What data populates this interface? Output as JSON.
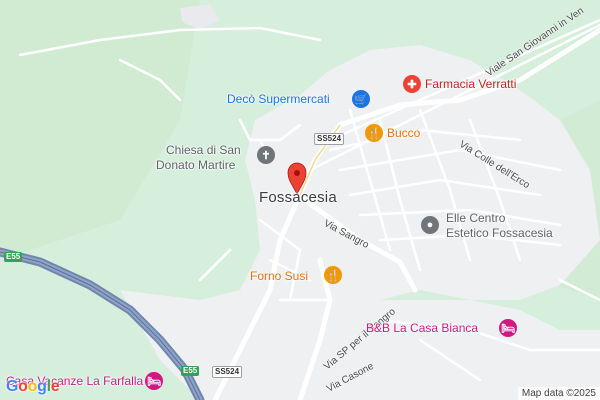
{
  "map": {
    "town": "Fossacesia",
    "roads": {
      "viale_san_giovanni": "Viale San Giovanni in Ven",
      "via_colle": "Via Colle dell'Erco",
      "via_sangro": "Via Sangro",
      "via_sp_sangro": "Via SP per il Sangro",
      "via_casone": "Via Casone",
      "ss524_top": "SS524",
      "ss524_bottom": "SS524",
      "e55_left": "E55",
      "e55_bottom": "E55"
    },
    "pois": {
      "farmacia": "Farmacia Verratti",
      "deco": "Decò Supermercati",
      "bucco": "Bucco",
      "chiesa_line1": "Chiesa di San",
      "chiesa_line2": "Donato Martire",
      "elle_line1": "Elle Centro",
      "elle_line2": "Estetico Fossacesia",
      "forno": "Forno Susi",
      "bnb": "B&B La Casa Bianca",
      "farfalla": "Casa Vacanze La Farfalla"
    },
    "attribution": "Map data ©2025",
    "logo": "Google",
    "colors": {
      "land": "#d6eedc",
      "urban": "#eef0f2",
      "road": "#ffffff",
      "highway": "#7a90b8",
      "pin": "#ea4335"
    }
  }
}
